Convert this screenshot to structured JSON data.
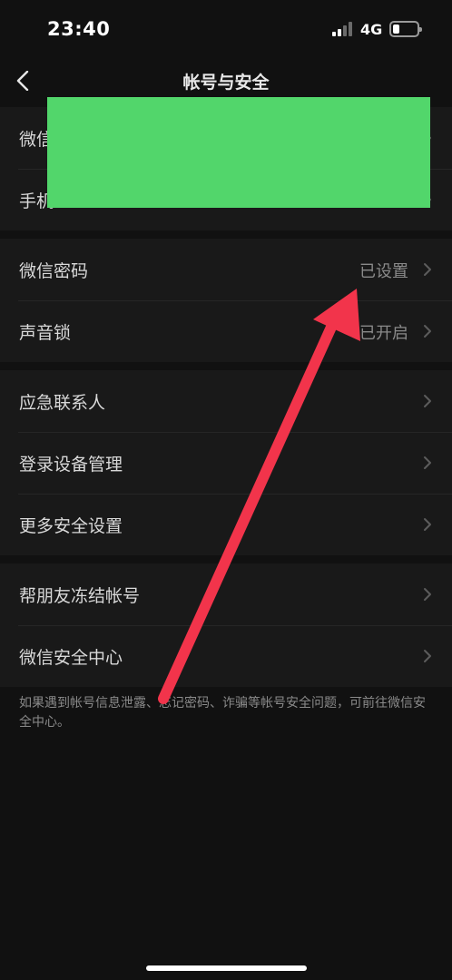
{
  "status_bar": {
    "time": "23:40",
    "network": "4G"
  },
  "nav": {
    "title": "帐号与安全"
  },
  "groups": [
    {
      "items": [
        {
          "label": "微信"
        },
        {
          "label": "手机"
        }
      ]
    },
    {
      "items": [
        {
          "label": "微信密码",
          "value": "已设置"
        },
        {
          "label": "声音锁",
          "value": "已开启"
        }
      ]
    },
    {
      "items": [
        {
          "label": "应急联系人"
        },
        {
          "label": "登录设备管理"
        },
        {
          "label": "更多安全设置"
        }
      ]
    },
    {
      "items": [
        {
          "label": "帮朋友冻结帐号"
        },
        {
          "label": "微信安全中心"
        }
      ]
    }
  ],
  "footnote": "如果遇到帐号信息泄露、忘记密码、诈骗等帐号安全问题，可前往微信安全中心。",
  "colors": {
    "background": "#111111",
    "cell": "#191919",
    "redaction": "#52d66b",
    "annotation_arrow": "#f2344b"
  }
}
